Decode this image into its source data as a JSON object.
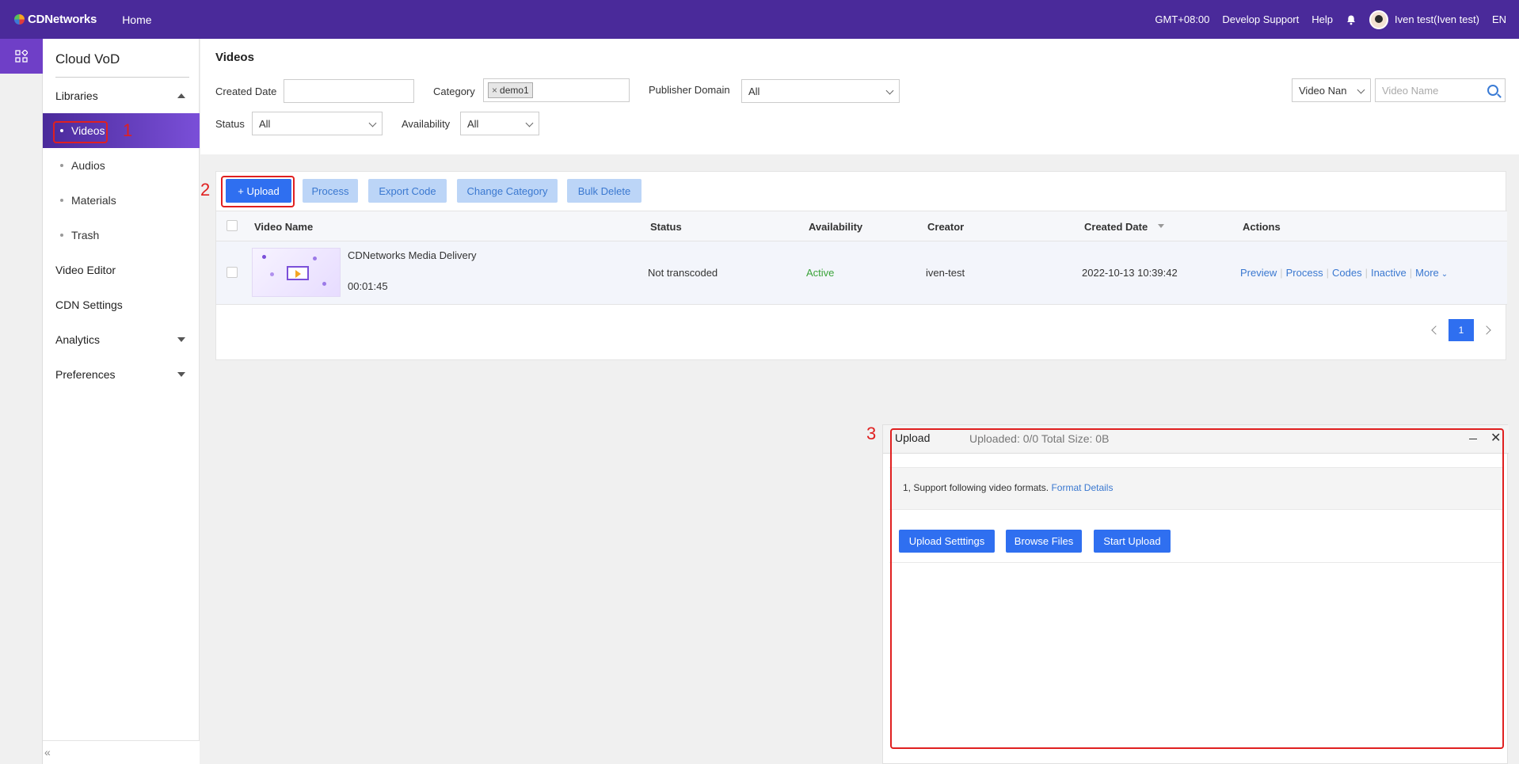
{
  "topbar": {
    "brand": "CDNetworks",
    "home": "Home",
    "timezone": "GMT+08:00",
    "develop_support": "Develop Support",
    "help": "Help",
    "user": "Iven test(Iven test)",
    "lang": "EN",
    "bg_color": "#4a2a9a"
  },
  "sidebar": {
    "title": "Cloud VoD",
    "libraries": "Libraries",
    "items": [
      {
        "label": "Videos"
      },
      {
        "label": "Audios"
      },
      {
        "label": "Materials"
      },
      {
        "label": "Trash"
      }
    ],
    "video_editor": "Video Editor",
    "cdn_settings": "CDN Settings",
    "analytics": "Analytics",
    "preferences": "Preferences",
    "collapse": "«"
  },
  "filters": {
    "page_title": "Videos",
    "created_date_label": "Created Date",
    "created_date_value": "",
    "category_label": "Category",
    "category_tag": "demo1",
    "publisher_domain_label": "Publisher Domain",
    "publisher_domain_value": "All",
    "status_label": "Status",
    "status_value": "All",
    "availability_label": "Availability",
    "availability_value": "All",
    "search_field_select": "Video Nan",
    "search_placeholder": "Video Name"
  },
  "toolbar": {
    "upload": "+ Upload",
    "process": "Process",
    "export_code": "Export Code",
    "change_category": "Change Category",
    "bulk_delete": "Bulk Delete"
  },
  "table": {
    "columns": [
      "Video Name",
      "Status",
      "Availability",
      "Creator",
      "Created Date",
      "Actions"
    ],
    "rows": [
      {
        "name": "CDNetworks Media Delivery",
        "duration": "00:01:45",
        "status": "Not transcoded",
        "availability": "Active",
        "creator": "iven-test",
        "created_date": "2022-10-13 10:39:42",
        "actions": [
          "Preview",
          "Process",
          "Codes",
          "Inactive",
          "More"
        ]
      }
    ]
  },
  "pagination": {
    "current": "1"
  },
  "upload_panel": {
    "title": "Upload",
    "status": "Uploaded:  0/0 Total Size:  0B",
    "note": "1, Support following video formats.",
    "note_link": "Format Details",
    "btn_settings": "Upload Setttings",
    "btn_browse": "Browse Files",
    "btn_start": "Start Upload"
  },
  "annotations": [
    "1",
    "2",
    "3"
  ]
}
